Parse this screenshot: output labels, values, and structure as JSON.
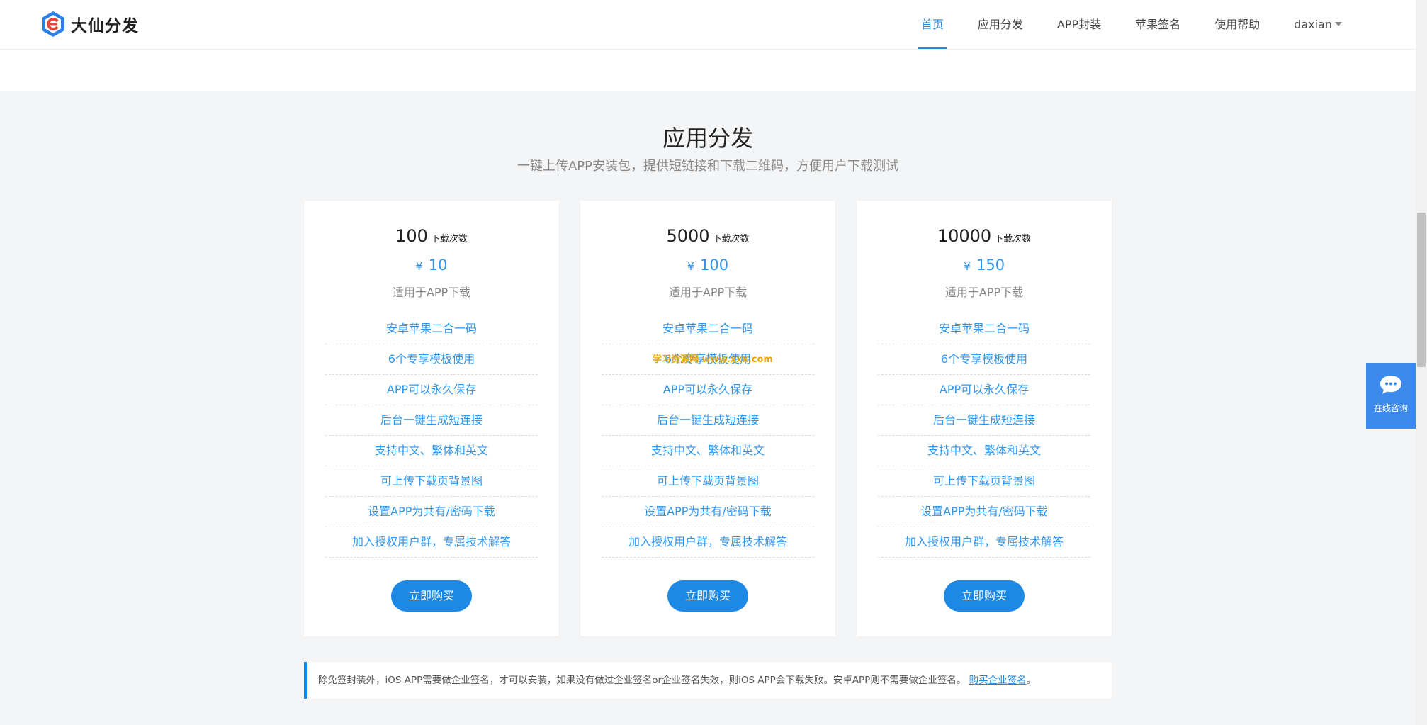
{
  "header": {
    "logo_text": "大仙分发",
    "nav": [
      {
        "label": "首页",
        "active": true
      },
      {
        "label": "应用分发",
        "active": false
      },
      {
        "label": "APP封装",
        "active": false
      },
      {
        "label": "苹果签名",
        "active": false
      },
      {
        "label": "使用帮助",
        "active": false
      }
    ],
    "user": "daxian"
  },
  "section": {
    "title": "应用分发",
    "subtitle": "一键上传APP安装包，提供短链接和下载二维码，方便用户下载测试"
  },
  "plans": [
    {
      "amount": "100",
      "unit": "下载次数",
      "currency": "¥",
      "price": "10",
      "note": "适用于APP下载",
      "features": [
        "安卓苹果二合一码",
        "6个专享模板使用",
        "APP可以永久保存",
        "后台一键生成短连接",
        "支持中文、繁体和英文",
        "可上传下载页背景图",
        "设置APP为共有/密码下载",
        "加入授权用户群，专属技术解答"
      ],
      "button": "立即购买"
    },
    {
      "amount": "5000",
      "unit": "下载次数",
      "currency": "¥",
      "price": "100",
      "note": "适用于APP下载",
      "features": [
        "安卓苹果二合一码",
        "6个专享模板使用",
        "APP可以永久保存",
        "后台一键生成短连接",
        "支持中文、繁体和英文",
        "可上传下载页背景图",
        "设置APP为共有/密码下载",
        "加入授权用户群，专属技术解答"
      ],
      "button": "立即购买"
    },
    {
      "amount": "10000",
      "unit": "下载次数",
      "currency": "¥",
      "price": "150",
      "note": "适用于APP下载",
      "features": [
        "安卓苹果二合一码",
        "6个专享模板使用",
        "APP可以永久保存",
        "后台一键生成短连接",
        "支持中文、繁体和英文",
        "可上传下载页背景图",
        "设置APP为共有/密码下载",
        "加入授权用户群，专属技术解答"
      ],
      "button": "立即购买"
    }
  ],
  "notice": {
    "text": "除免签封装外，iOS APP需要做企业签名，才可以安装，如果没有做过企业签名or企业签名失效，则iOS APP会下载失败。安卓APP则不需要做企业签名。",
    "link": "购买企业签名",
    "tail": "。"
  },
  "consult": {
    "label": "在线咨询",
    "icon": "chat-bubble-icon"
  },
  "watermark": "学习资源网 www.xxx.com",
  "colors": {
    "accent": "#1e88e5",
    "link": "#2f96f0",
    "consult": "#3c8bec"
  }
}
